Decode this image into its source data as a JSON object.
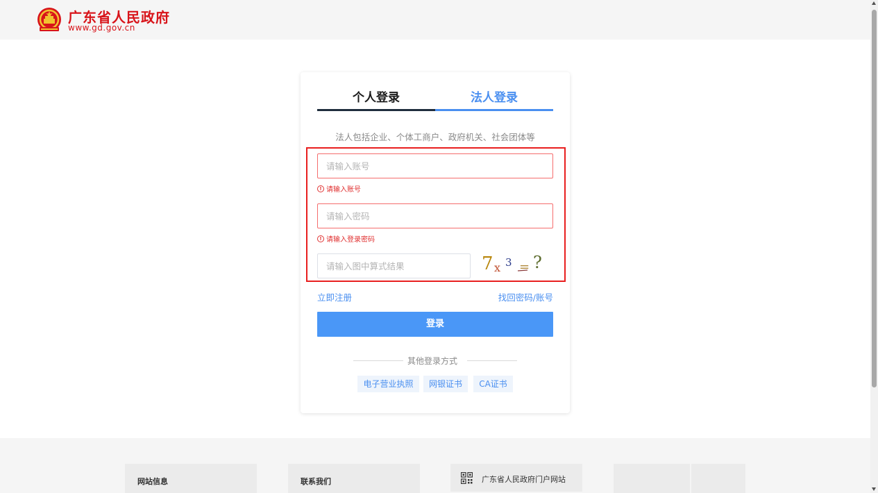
{
  "header": {
    "title": "广东省人民政府",
    "url": "www.gd.gov.cn",
    "emblem_icon": "national-emblem-icon"
  },
  "login": {
    "tabs": [
      {
        "label": "个人登录",
        "active": false
      },
      {
        "label": "法人登录",
        "active": true
      }
    ],
    "hint": "法人包括企业、个体工商户、政府机关、社会团体等",
    "account_placeholder": "请输入账号",
    "account_value": "",
    "account_error": "请输入账号",
    "password_placeholder": "请输入密码",
    "password_value": "",
    "password_error": "请输入登录密码",
    "captcha_placeholder": "请输入图中算式结果",
    "captcha_value": "",
    "captcha_image": {
      "a": "7",
      "op": "x",
      "b": "3",
      "eq": "=",
      "q": "?"
    },
    "register_label": "立即注册",
    "recover_label": "找回密码/账号",
    "login_label": "登录",
    "other_methods_label": "其他登录方式",
    "other_methods": [
      "电子营业执照",
      "网银证书",
      "CA证书"
    ]
  },
  "footer": {
    "site_info": "网站信息",
    "contact_us": "联系我们",
    "portal_label": "广东省人民政府门户网站",
    "portal_icon": "qr-code-icon"
  },
  "colors": {
    "brand_red": "#d8141a",
    "primary_blue": "#4a97f7",
    "error_red": "#e03131",
    "highlight_red": "#e81e1e"
  }
}
